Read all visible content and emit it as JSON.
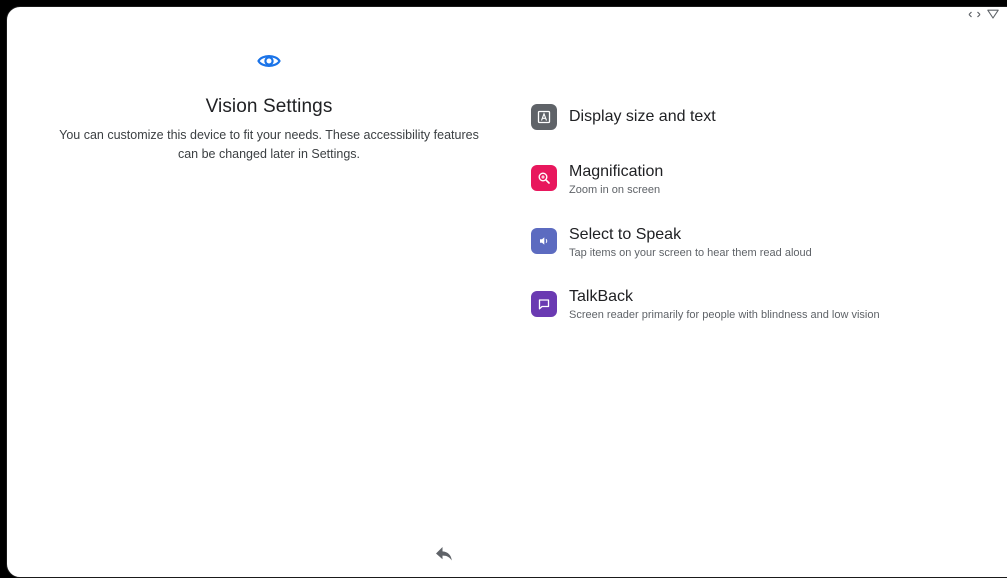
{
  "header": {
    "title": "Vision Settings",
    "description": "You can customize this device to fit your needs. These accessibility features can be changed later in Settings."
  },
  "status_bar": {
    "icons": [
      "rotate-icon",
      "wifi-icon"
    ]
  },
  "options": [
    {
      "title": "Display size and text",
      "summary": "",
      "icon": "text-size-icon",
      "color": "#5f6368"
    },
    {
      "title": "Magnification",
      "summary": "Zoom in on screen",
      "icon": "magnify-icon",
      "color": "#e8175d"
    },
    {
      "title": "Select to Speak",
      "summary": "Tap items on your screen to hear them read aloud",
      "icon": "speaker-icon",
      "color": "#5c6bc0"
    },
    {
      "title": "TalkBack",
      "summary": "Screen reader primarily for people with blindness and low vision",
      "icon": "chat-bubble-icon",
      "color": "#6a3ab2"
    }
  ],
  "colors": {
    "accent": "#1a73e8",
    "text_primary": "#202124",
    "text_secondary": "#5f6368"
  },
  "nav": {
    "back_icon": "back-arrow-icon"
  }
}
